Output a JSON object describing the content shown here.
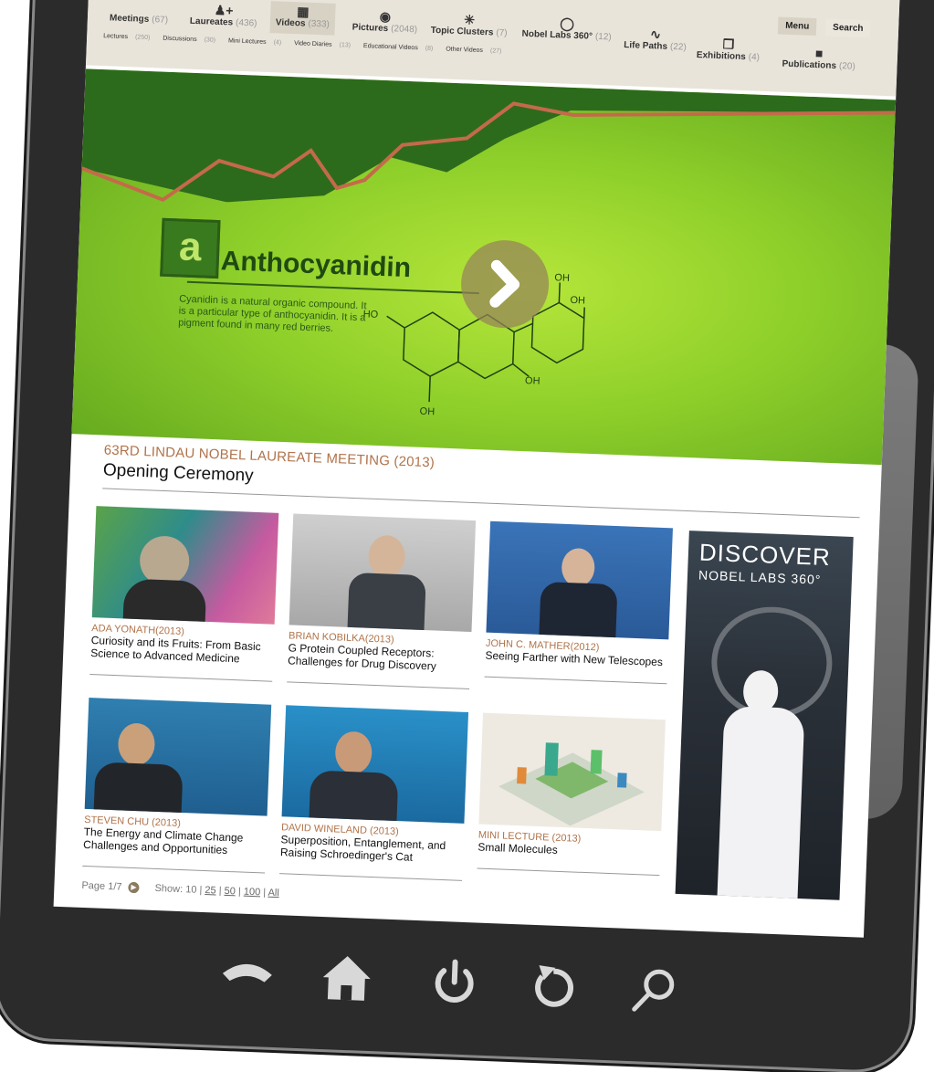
{
  "nav": {
    "items": [
      {
        "label": "Meetings",
        "count": "(67)",
        "icon": "calendar-icon"
      },
      {
        "label": "Laureates",
        "count": "(436)",
        "icon": "person-add-icon"
      },
      {
        "label": "Videos",
        "count": "(333)",
        "icon": "film-icon"
      },
      {
        "label": "Pictures",
        "count": "(2048)",
        "icon": "camera-icon"
      },
      {
        "label": "Topic Clusters",
        "count": "(7)",
        "icon": "cluster-icon"
      },
      {
        "label": "Nobel Labs 360°",
        "count": "(12)",
        "icon": "panorama-icon"
      },
      {
        "label": "Life Paths",
        "count": "(22)",
        "icon": "path-icon"
      },
      {
        "label": "Exhibitions",
        "count": "(4)",
        "icon": "exhibition-icon"
      },
      {
        "label": "Publications",
        "count": "(20)",
        "icon": "book-icon"
      }
    ],
    "menu": "Menu",
    "search": "Search"
  },
  "subnav": [
    {
      "label": "Lectures",
      "count": "(250)"
    },
    {
      "label": "Discussions",
      "count": "(30)"
    },
    {
      "label": "Mini Lectures",
      "count": "(4)"
    },
    {
      "label": "Video Diaries",
      "count": "(13)"
    },
    {
      "label": "Educational Videos",
      "count": "(8)"
    },
    {
      "label": "Other Videos",
      "count": "(27)"
    }
  ],
  "hero": {
    "letter": "a",
    "title": "Anthocyanidin",
    "description": "Cyanidin is a natural organic compound. It is a particular type of anthocyanidin. It is a pigment found in many red berries.",
    "oh_labels": [
      "OH",
      "OH",
      "HO",
      "OH",
      "OH"
    ],
    "meta": "63RD LINDAU NOBEL LAUREATE MEETING (2013)",
    "title_below": "Opening Ceremony"
  },
  "cards": [
    {
      "meta": "ADA YONATH(2013)",
      "title": "Curiosity and its Fruits: From Basic Science to Advanced Medicine"
    },
    {
      "meta": "BRIAN KOBILKA(2013)",
      "title": "G Protein Coupled Receptors: Challenges for Drug Discovery"
    },
    {
      "meta": "JOHN C. MATHER(2012)",
      "title": "Seeing Farther with New Telescopes"
    },
    {
      "meta": "STEVEN CHU (2013)",
      "title": "The Energy and Climate Change Challenges and Opportunities"
    },
    {
      "meta": "DAVID WINELAND (2013)",
      "title": "Superposition, Entanglement, and Raising Schroedinger's Cat"
    },
    {
      "meta": "MINI LECTURE (2013)",
      "title": "Small Molecules"
    }
  ],
  "promo": {
    "line1": "DISCOVER",
    "line2": "NOBEL LABS 360°"
  },
  "pager": {
    "page": "Page 1/7",
    "show_label": "Show:",
    "current": "10",
    "options": [
      "25",
      "50",
      "100",
      "All"
    ]
  },
  "hardware": [
    "phone-icon",
    "home-icon",
    "power-icon",
    "back-icon",
    "search-icon"
  ]
}
